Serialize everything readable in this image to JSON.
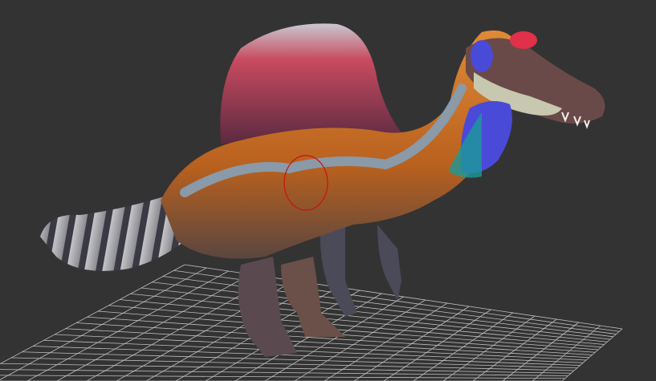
{
  "viewport": {
    "background_color": "#333333",
    "grid_color": "#bfbfbf",
    "model": {
      "body_color": "#c8702a",
      "sail_color": "#b8425a",
      "stripe_color": "#8a9aa8",
      "throat_color": "#4a4ad8",
      "crest_color": "#e0304a"
    },
    "brush_cursor_color": "#cc1010"
  }
}
